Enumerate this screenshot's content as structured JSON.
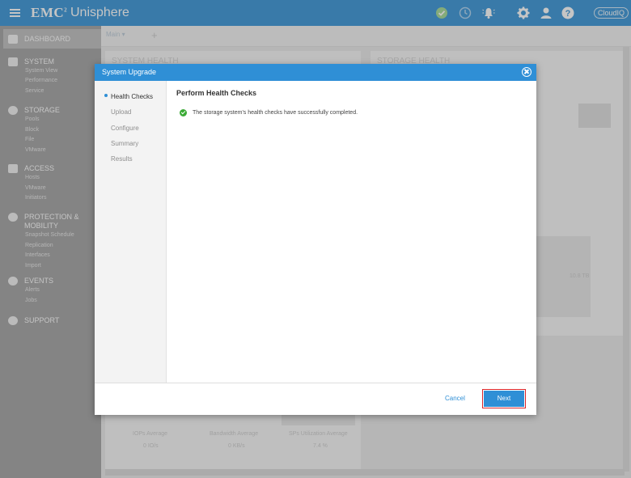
{
  "app": {
    "brand": "EMC",
    "brand_sup": "2",
    "name": "Unisphere",
    "cloudiq": "CloudIQ",
    "icons": [
      "menu-icon",
      "health-check-icon",
      "clock-icon",
      "bell-icon",
      "gear-icon",
      "user-icon",
      "help-icon"
    ]
  },
  "sidebar": {
    "dashboard": "DASHBOARD",
    "system": {
      "label": "SYSTEM",
      "items": [
        "System View",
        "Performance",
        "Service"
      ]
    },
    "storage": {
      "label": "STORAGE",
      "items": [
        "Pools",
        "Block",
        "File",
        "VMware"
      ]
    },
    "access": {
      "label": "ACCESS",
      "items": [
        "Hosts",
        "VMware",
        "Initiators"
      ]
    },
    "protection": {
      "label_line1": "PROTECTION &",
      "label_line2": "MOBILITY",
      "items": [
        "Snapshot Schedule",
        "Replication",
        "Interfaces",
        "Import"
      ]
    },
    "events": {
      "label": "EVENTS",
      "items": [
        "Alerts",
        "Jobs"
      ]
    },
    "support": {
      "label": "SUPPORT"
    }
  },
  "main": {
    "tab": "Main",
    "system_health": "SYSTEM HEALTH",
    "storage_health": "STORAGE HEALTH",
    "capacity_label": "10.8 TB",
    "metrics": [
      {
        "label": "IOPs Average",
        "value": "0 IO/s"
      },
      {
        "label": "Bandwidth Average",
        "value": "0 KB/s"
      },
      {
        "label": "SPs Utilization Average",
        "value": "7.4 %"
      }
    ]
  },
  "dialog": {
    "title": "System Upgrade",
    "steps": [
      "Health Checks",
      "Upload",
      "Configure",
      "Summary",
      "Results"
    ],
    "active_step": "Health Checks",
    "heading": "Perform Health Checks",
    "message": "The storage system's health checks have successfully completed.",
    "cancel": "Cancel",
    "next": "Next",
    "colors": {
      "accent": "#2f8fd6",
      "success": "#3aaa35",
      "highlight": "#d9262c"
    }
  }
}
